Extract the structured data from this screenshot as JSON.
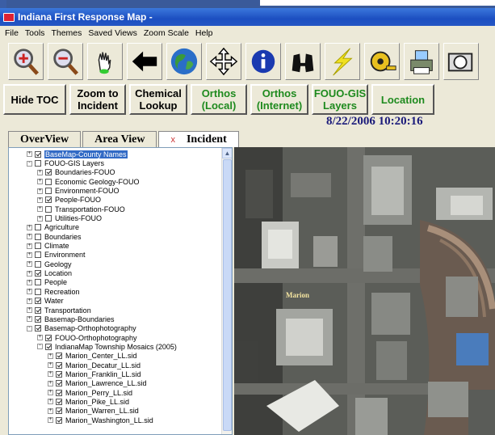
{
  "window": {
    "title": "Indiana First Response Map -"
  },
  "menu": [
    "File",
    "Tools",
    "Themes",
    "Saved Views",
    "Zoom Scale",
    "Help"
  ],
  "toolbar_icons": [
    "zoom-in-icon",
    "zoom-out-icon",
    "pan-hand-icon",
    "back-arrow-icon",
    "globe-icon",
    "move-arrows-icon",
    "info-icon",
    "binoculars-icon",
    "lightning-icon",
    "measure-tape-icon",
    "print-icon",
    "camera-icon"
  ],
  "buttons": {
    "hide_toc": "Hide TOC",
    "zoom_incident_1": "Zoom to",
    "zoom_incident_2": "Incident",
    "chemical_1": "Chemical",
    "chemical_2": "Lookup",
    "orthos_local_1": "Orthos",
    "orthos_local_2": "(Local)",
    "orthos_internet_1": "Orthos",
    "orthos_internet_2": "(Internet)",
    "fouo_1": "FOUO-GIS",
    "fouo_2": "Layers",
    "location": "Location"
  },
  "datetime": "8/22/2006  10:20:16",
  "tabs": {
    "overview": "OverView",
    "area": "Area View",
    "close": "x",
    "incident": "Incident"
  },
  "toc": [
    {
      "label": "BaseMap-County Names",
      "indent": 0,
      "checked": true,
      "expander": "+",
      "selected": true
    },
    {
      "label": "FOUO-GIS Layers",
      "indent": 0,
      "checked": false,
      "expander": "-"
    },
    {
      "label": "Boundaries-FOUO",
      "indent": 1,
      "checked": true,
      "expander": "+"
    },
    {
      "label": "Economic Geology-FOUO",
      "indent": 1,
      "checked": false,
      "expander": "+"
    },
    {
      "label": "Environment-FOUO",
      "indent": 1,
      "checked": false,
      "expander": "+"
    },
    {
      "label": "People-FOUO",
      "indent": 1,
      "checked": true,
      "expander": "+"
    },
    {
      "label": "Transportation-FOUO",
      "indent": 1,
      "checked": false,
      "expander": "+"
    },
    {
      "label": "Utilities-FOUO",
      "indent": 1,
      "checked": false,
      "expander": "+"
    },
    {
      "label": "Agriculture",
      "indent": 0,
      "checked": false,
      "expander": "+"
    },
    {
      "label": "Boundaries",
      "indent": 0,
      "checked": false,
      "expander": "+"
    },
    {
      "label": "Climate",
      "indent": 0,
      "checked": false,
      "expander": "+"
    },
    {
      "label": "Environment",
      "indent": 0,
      "checked": false,
      "expander": "+"
    },
    {
      "label": "Geology",
      "indent": 0,
      "checked": false,
      "expander": "+"
    },
    {
      "label": "Location",
      "indent": 0,
      "checked": true,
      "expander": "+"
    },
    {
      "label": "People",
      "indent": 0,
      "checked": false,
      "expander": "+"
    },
    {
      "label": "Recreation",
      "indent": 0,
      "checked": false,
      "expander": "+"
    },
    {
      "label": "Water",
      "indent": 0,
      "checked": true,
      "expander": "+"
    },
    {
      "label": "Transportation",
      "indent": 0,
      "checked": true,
      "expander": "+"
    },
    {
      "label": "Basemap-Boundaries",
      "indent": 0,
      "checked": true,
      "expander": "+"
    },
    {
      "label": "Basemap-Orthophotography",
      "indent": 0,
      "checked": true,
      "expander": "-"
    },
    {
      "label": "FOUO-Orthophotography",
      "indent": 1,
      "checked": true,
      "expander": "+"
    },
    {
      "label": "IndianaMap Township Mosaics (2005)",
      "indent": 1,
      "checked": true,
      "expander": "-"
    },
    {
      "label": "Marion_Center_LL.sid",
      "indent": 2,
      "checked": true,
      "expander": "+"
    },
    {
      "label": "Marion_Decatur_LL.sid",
      "indent": 2,
      "checked": true,
      "expander": "+"
    },
    {
      "label": "Marion_Franklin_LL.sid",
      "indent": 2,
      "checked": true,
      "expander": "+"
    },
    {
      "label": "Marion_Lawrence_LL.sid",
      "indent": 2,
      "checked": true,
      "expander": "+"
    },
    {
      "label": "Marion_Perry_LL.sid",
      "indent": 2,
      "checked": true,
      "expander": "+"
    },
    {
      "label": "Marion_Pike_LL.sid",
      "indent": 2,
      "checked": true,
      "expander": "+"
    },
    {
      "label": "Marion_Warren_LL.sid",
      "indent": 2,
      "checked": true,
      "expander": "+"
    },
    {
      "label": "Marion_Washington_LL.sid",
      "indent": 2,
      "checked": true,
      "expander": "+"
    }
  ],
  "map": {
    "street_label": "Marion"
  }
}
